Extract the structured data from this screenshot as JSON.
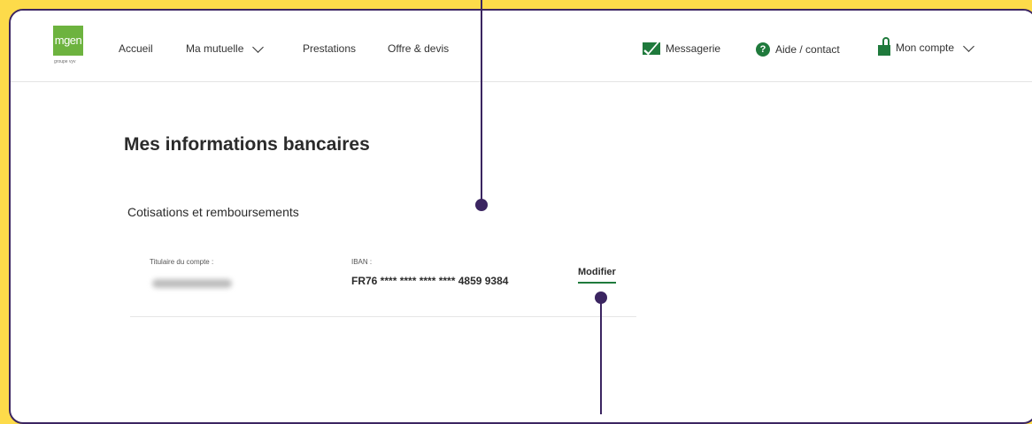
{
  "brand": {
    "logo_text": "mgen",
    "logo_sub": "groupe vyv"
  },
  "nav": {
    "items": [
      {
        "label": "Accueil"
      },
      {
        "label": "Ma mutuelle"
      },
      {
        "label": "Prestations"
      },
      {
        "label": "Offre & devis"
      }
    ],
    "right": {
      "messagerie": "Messagerie",
      "aide": "Aide / contact",
      "compte": "Mon compte"
    }
  },
  "main": {
    "title": "Mes informations bancaires",
    "section_title": "Cotisations et remboursements",
    "card": {
      "holder_label": "Titulaire du compte :",
      "iban_label": "IBAN :",
      "iban_value": "FR76 **** **** **** **** 4859 9384",
      "modify_label": "Modifier"
    }
  },
  "colors": {
    "accent": "#1f7a3c",
    "frame": "#3b2561",
    "background": "#fddb4a",
    "logo": "#6db33f"
  },
  "icons": [
    "envelope-icon",
    "help-icon",
    "lock-icon",
    "chevron-down-icon"
  ]
}
